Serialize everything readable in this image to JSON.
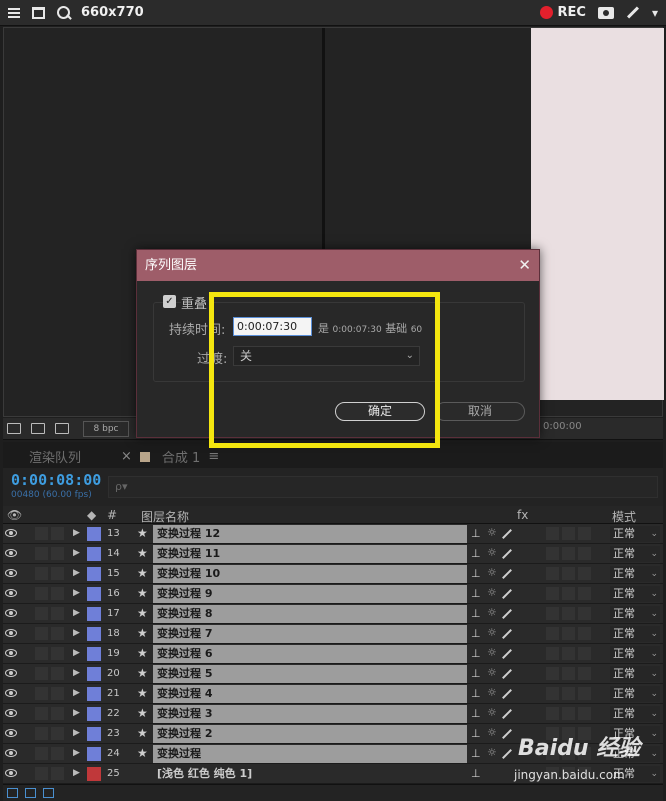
{
  "recorder": {
    "size_label": "660x770",
    "rec_label": "REC"
  },
  "viewer": {
    "bpc_label": "8 bpc",
    "time_label": "0:00:00"
  },
  "panels": {
    "render_queue_tab": "渲染队列",
    "comp_tab": "合成 1"
  },
  "timeline": {
    "timecode": "0:00:08:00",
    "fps": "00480 (60.00 fps)",
    "search_placeholder": "ρ▾",
    "header": {
      "hash": "#",
      "layer_name": "图层名称",
      "mode": "模式",
      "fx": "fx"
    },
    "layers": [
      {
        "num": "13",
        "name": "变换过程 12",
        "mode": "正常",
        "color": "#6f7fd8"
      },
      {
        "num": "14",
        "name": "变换过程 11",
        "mode": "正常",
        "color": "#6f7fd8"
      },
      {
        "num": "15",
        "name": "变换过程 10",
        "mode": "正常",
        "color": "#6f7fd8"
      },
      {
        "num": "16",
        "name": "变换过程 9",
        "mode": "正常",
        "color": "#6f7fd8"
      },
      {
        "num": "17",
        "name": "变换过程 8",
        "mode": "正常",
        "color": "#6f7fd8"
      },
      {
        "num": "18",
        "name": "变换过程 7",
        "mode": "正常",
        "color": "#6f7fd8"
      },
      {
        "num": "19",
        "name": "变换过程 6",
        "mode": "正常",
        "color": "#6f7fd8"
      },
      {
        "num": "20",
        "name": "变换过程 5",
        "mode": "正常",
        "color": "#6f7fd8"
      },
      {
        "num": "21",
        "name": "变换过程 4",
        "mode": "正常",
        "color": "#6f7fd8"
      },
      {
        "num": "22",
        "name": "变换过程 3",
        "mode": "正常",
        "color": "#6f7fd8"
      },
      {
        "num": "23",
        "name": "变换过程 2",
        "mode": "正常",
        "color": "#6f7fd8"
      },
      {
        "num": "24",
        "name": "变换过程",
        "mode": "正常",
        "color": "#6f7fd8"
      },
      {
        "num": "25",
        "name": "[浅色 红色 纯色 1]",
        "mode": "正常",
        "color": "#c0383a"
      }
    ]
  },
  "dialog": {
    "title": "序列图层",
    "overlap_label": "重叠",
    "duration_label": "持续时间:",
    "duration_value": "0:00:07:30",
    "duration_is": "是",
    "duration_is_value": "0:00:07:30",
    "duration_base": "基础",
    "duration_base_value": "60",
    "transition_label": "过渡:",
    "transition_value": "关",
    "ok_label": "确定",
    "cancel_label": "取消"
  },
  "watermark": {
    "brand": "Baidu 经验",
    "url": "jingyan.baidu.com"
  },
  "colors": {
    "dialog_title_bg": "#9e5d69",
    "highlight": "#f4e60f",
    "timecode": "#3e9de0"
  }
}
